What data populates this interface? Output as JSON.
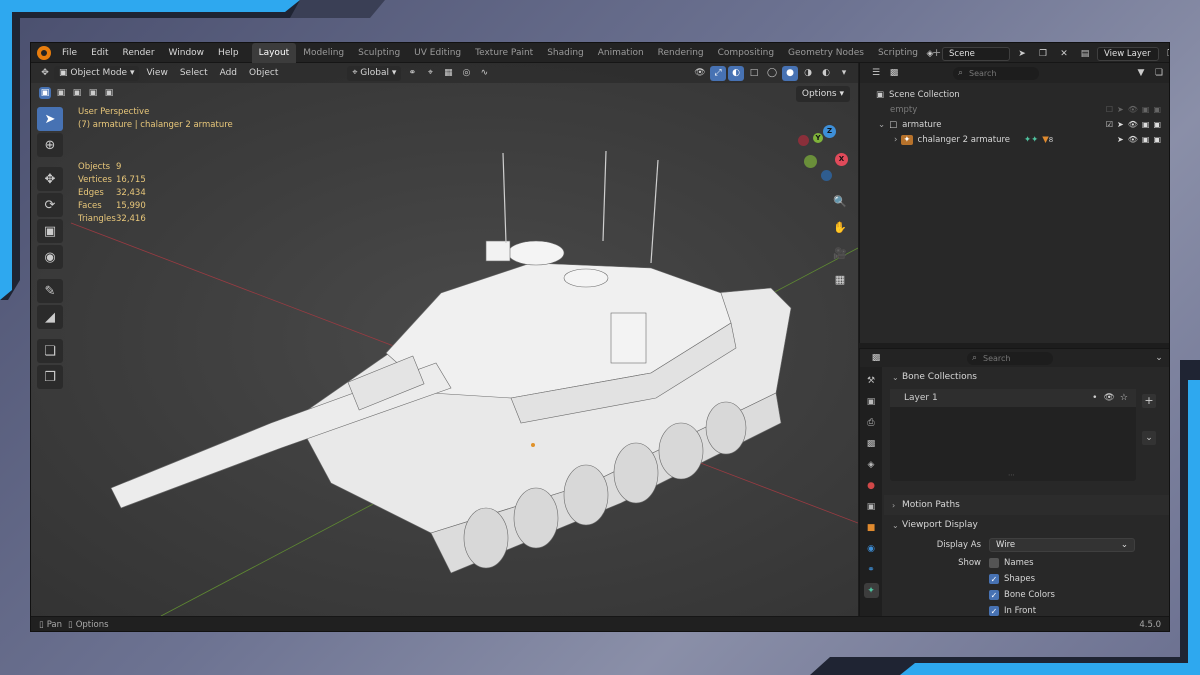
{
  "topbar": {
    "menus": [
      "File",
      "Edit",
      "Render",
      "Window",
      "Help"
    ],
    "workspaces": [
      "Layout",
      "Modeling",
      "Sculpting",
      "UV Editing",
      "Texture Paint",
      "Shading",
      "Animation",
      "Rendering",
      "Compositing",
      "Geometry Nodes",
      "Scripting"
    ],
    "active_workspace": "Layout",
    "add_tab": "+",
    "scene_label": "Scene",
    "view_layer_label": "View Layer"
  },
  "viewport": {
    "mode": "Object Mode",
    "menus": [
      "View",
      "Select",
      "Add",
      "Object"
    ],
    "transform_orientation": "Global",
    "options_label": "Options",
    "perspective_label": "User Perspective",
    "active_object_label": "(7) armature | chalanger 2 armature",
    "stats": [
      {
        "key": "Objects",
        "value": "9"
      },
      {
        "key": "Vertices",
        "value": "16,715"
      },
      {
        "key": "Edges",
        "value": "32,434"
      },
      {
        "key": "Faces",
        "value": "15,990"
      },
      {
        "key": "Triangles",
        "value": "32,416"
      }
    ],
    "gizmo": {
      "x": "X",
      "y": "Y",
      "z": "Z"
    }
  },
  "outliner": {
    "search_placeholder": "Search",
    "root": "Scene Collection",
    "items": [
      {
        "label": "empty",
        "dim": true
      },
      {
        "label": "armature",
        "dim": false
      },
      {
        "label": "chalanger 2 armature",
        "dim": false,
        "badge": "8"
      }
    ]
  },
  "properties": {
    "search_placeholder": "Search",
    "panels": {
      "bone_collections": "Bone Collections",
      "layer_name": "Layer 1",
      "motion_paths": "Motion Paths",
      "viewport_display": "Viewport Display"
    },
    "display_as_label": "Display As",
    "display_as_value": "Wire",
    "show_label": "Show",
    "checkboxes": [
      {
        "label": "Names",
        "checked": false
      },
      {
        "label": "Shapes",
        "checked": true
      },
      {
        "label": "Bone Colors",
        "checked": true
      },
      {
        "label": "In Front",
        "checked": true
      }
    ]
  },
  "statusbar": {
    "pan_label": "Pan",
    "options_label": "Options",
    "version": "4.5.0"
  },
  "colors": {
    "accent": "#4772b3",
    "frame_blue": "#1e9be0",
    "overlay_text": "#e8c77a",
    "axis_x": "#e04a5a",
    "axis_y": "#7fb33a",
    "axis_z": "#3d8fd8"
  }
}
